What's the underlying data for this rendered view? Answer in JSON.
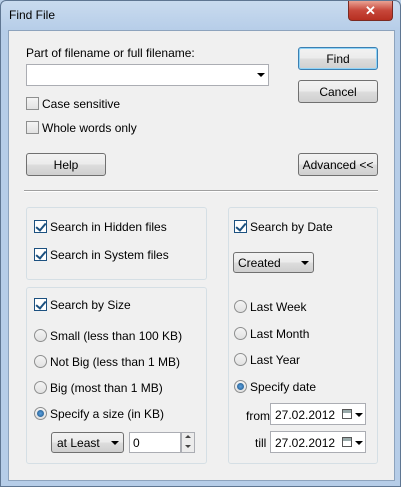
{
  "window": {
    "title": "Find File",
    "close_glyph": "✕"
  },
  "filename": {
    "label": "Part of filename or full filename:",
    "value": "",
    "case_sensitive": {
      "label": "Case sensitive",
      "checked": false
    },
    "whole_words": {
      "label": "Whole words only",
      "checked": false
    }
  },
  "buttons": {
    "find": "Find",
    "cancel": "Cancel",
    "help": "Help",
    "advanced": "Advanced <<"
  },
  "hidden_system": {
    "hidden": {
      "label": "Search in Hidden files",
      "checked": true
    },
    "system": {
      "label": "Search in System files",
      "checked": true
    }
  },
  "size": {
    "label": "Search by Size",
    "checked": true,
    "options": [
      {
        "label": "Small (less than 100 KB)",
        "selected": false
      },
      {
        "label": "Not Big (less than 1 MB)",
        "selected": false
      },
      {
        "label": "Big (most than 1 MB)",
        "selected": false
      },
      {
        "label": "Specify a size (in KB)",
        "selected": true
      }
    ],
    "comparator": "at Least",
    "amount": "0"
  },
  "date": {
    "label": "Search by Date",
    "checked": true,
    "type": "Created",
    "options": [
      {
        "label": "Last Week",
        "selected": false
      },
      {
        "label": "Last Month",
        "selected": false
      },
      {
        "label": "Last Year",
        "selected": false
      },
      {
        "label": "Specify date",
        "selected": true
      }
    ],
    "from_label": "from",
    "from_value": "27.02.2012",
    "till_label": "till",
    "till_value": "27.02.2012"
  }
}
